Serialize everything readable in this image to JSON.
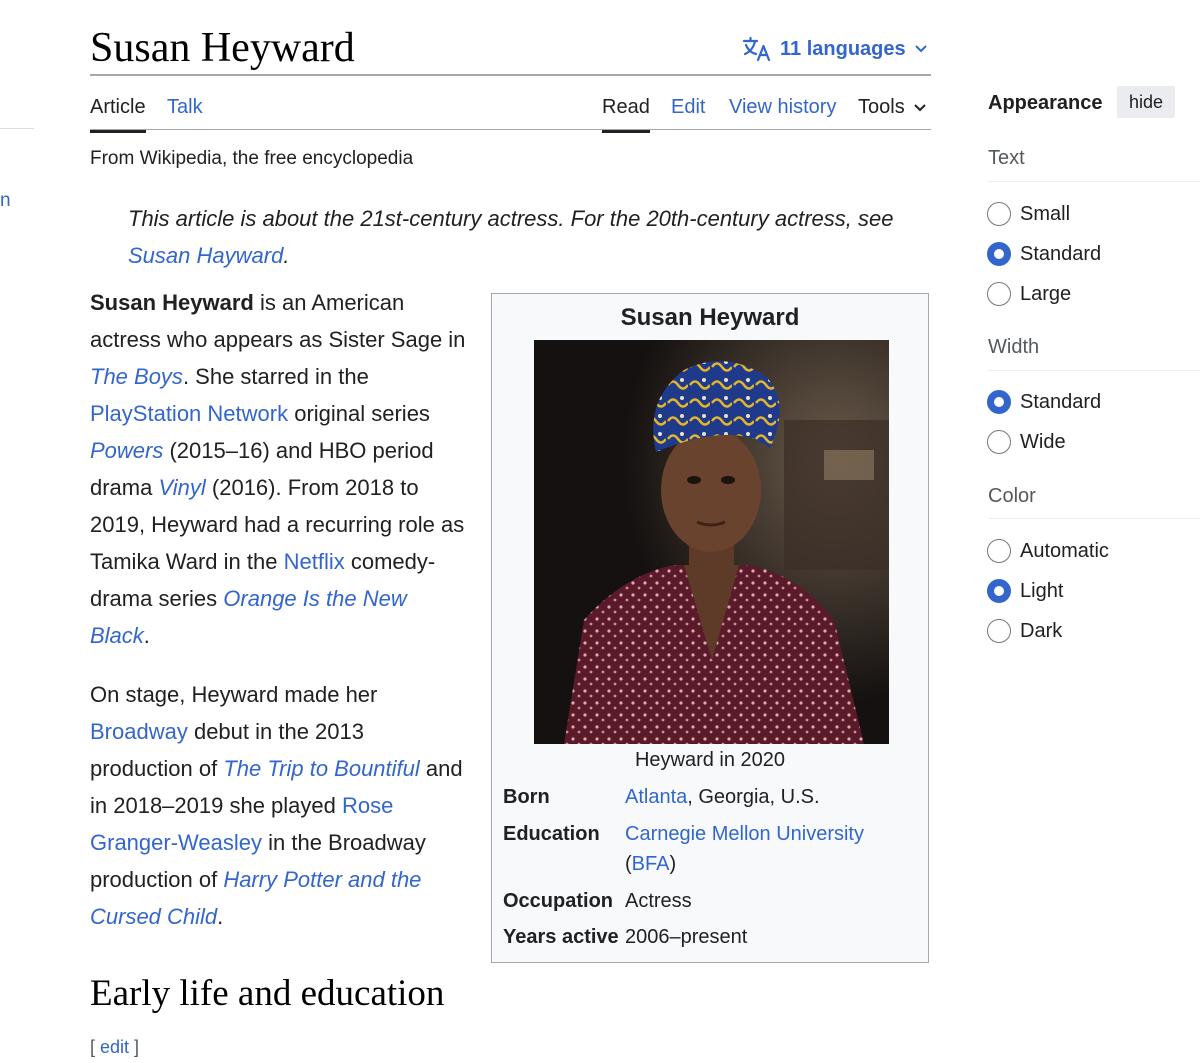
{
  "title": "Susan Heyward",
  "languages": {
    "label": "11 languages"
  },
  "tabs": {
    "article": "Article",
    "talk": "Talk",
    "read": "Read",
    "edit": "Edit",
    "view_history": "View history",
    "tools": "Tools"
  },
  "tagline": "From Wikipedia, the free encyclopedia",
  "hatnote": {
    "text": "This article is about the 21st-century actress. For the 20th-century actress, see",
    "link": "Susan Hayward",
    "end": "."
  },
  "para1": {
    "bold": "Susan Heyward",
    "t1": " is an American actress who appears as Sister Sage in ",
    "l1": "The Boys",
    "t2": ". She starred in the ",
    "l2": "PlayStation Network",
    "t3": " original series ",
    "l3": "Powers",
    "t4": " (2015–16) and HBO period drama ",
    "l4": "Vinyl",
    "t5": " (2016). From 2018 to 2019, Heyward had a recurring role as Tamika Ward in the ",
    "l5": "Netflix",
    "t6": " comedy-drama series ",
    "l6": "Orange Is the New Black",
    "t7": "."
  },
  "para2": {
    "t1": "On stage, Heyward made her ",
    "l1": "Broadway",
    "t2": " debut in the 2013 production of ",
    "l2": "The Trip to Bountiful",
    "t3": " and in 2018–2019 she played ",
    "l3": "Rose Granger-Weasley",
    "t4": " in the Broadway production of ",
    "l4": "Harry Potter and the Cursed Child",
    "t5": "."
  },
  "section": {
    "heading": "Early life and education",
    "edit_open": "[ ",
    "edit": "edit",
    "edit_close": " ]"
  },
  "infobox": {
    "title": "Susan Heyward",
    "caption": "Heyward in 2020",
    "born_label": "Born",
    "born_link": "Atlanta",
    "born_rest": ", Georgia, U.S.",
    "education_label": "Education",
    "education_link": "Carnegie Mellon University",
    "education_open": "(",
    "education_link2": "BFA",
    "education_close": ")",
    "occupation_label": "Occupation",
    "occupation_value": "Actress",
    "years_label": "Years active",
    "years_value": "2006–present"
  },
  "appearance": {
    "title": "Appearance",
    "hide": "hide",
    "text_label": "Text",
    "text_options": [
      "Small",
      "Standard",
      "Large"
    ],
    "text_selected": "Standard",
    "width_label": "Width",
    "width_options": [
      "Standard",
      "Wide"
    ],
    "width_selected": "Standard",
    "color_label": "Color",
    "color_options": [
      "Automatic",
      "Light",
      "Dark"
    ],
    "color_selected": "Light"
  },
  "colors": {
    "link": "#3366cc",
    "text": "#202122",
    "accent": "#3366cc",
    "border": "#a2a9b1"
  },
  "icons": {
    "languages": "translate-icon",
    "chevron": "chevron-down-icon",
    "radio": "radio-icon"
  }
}
